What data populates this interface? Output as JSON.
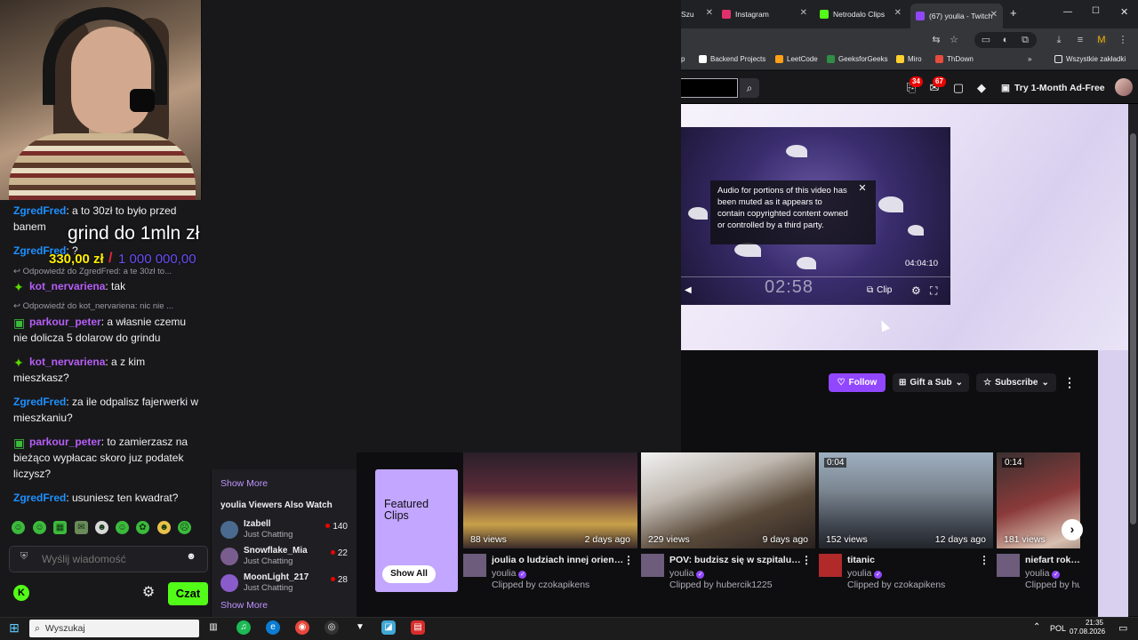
{
  "browser": {
    "tabs": [
      {
        "label": "Szu",
        "color": "#4285f4"
      },
      {
        "label": "Instagram",
        "color": "#e1306c"
      },
      {
        "label": "Netrodalo Clips",
        "color": "#53fc18"
      },
      {
        "label": "(67) youlia - Twitch",
        "color": "#9147ff"
      }
    ],
    "new_tab": "+",
    "bookmarks": [
      {
        "label": "Backend Projects",
        "color": "#ffffff"
      },
      {
        "label": "LeetCode",
        "color": "#ffa116"
      },
      {
        "label": "GeeksforGeeks",
        "color": "#2f8d46"
      },
      {
        "label": "Miro",
        "color": "#ffd02f"
      },
      {
        "label": "ThDown",
        "color": "#e74c3c"
      }
    ],
    "bookmarks_folder": "Wszystkie zakładki",
    "bookmark_partial": "p"
  },
  "twitch": {
    "search_placeholder": "",
    "notif_count_a": "34",
    "notif_count_b": "67",
    "ad_free_label": "Try 1-Month Ad-Free",
    "mute_notice": "Audio for portions of this video has been muted as it appears to contain copyrighted content owned or controlled by a third party.",
    "video_time": "04:04:10",
    "video_clock": "02:58",
    "clip_label": "Clip",
    "follow_label": "Follow",
    "gift_label": "Gift a Sub",
    "subscribe_label": "Subscribe"
  },
  "overlay": {
    "goal_text": "grind do 1mln zł",
    "current": "330,00 zł",
    "slash": "/",
    "target": "1 000 000,00"
  },
  "chat": {
    "messages": [
      {
        "type": "msg",
        "user": "ZgredFred",
        "user_color": "#1e90ff",
        "text": ": a to 30zł to było przed banem"
      },
      {
        "type": "msg",
        "user": "ZgredFred",
        "user_color": "#1e90ff",
        "text": ": ?"
      },
      {
        "type": "reply",
        "text": "Odpowiedź do ZgredFred: a te 30zł to..."
      },
      {
        "type": "msg",
        "user": "kot_nervariena",
        "user_color": "#b65ef5",
        "text": ": tak"
      },
      {
        "type": "reply",
        "text": "Odpowiedź do kot_nervariena: nic nie ..."
      },
      {
        "type": "msg",
        "user": "parkour_peter",
        "user_color": "#b65ef5",
        "text": ": a własnie czemu nie dolicza 5 dolarow do grindu"
      },
      {
        "type": "msg",
        "user": "kot_nervariena",
        "user_color": "#b65ef5",
        "text": ": a z kim mieszkasz?"
      },
      {
        "type": "msg",
        "user": "ZgredFred",
        "user_color": "#1e90ff",
        "text": ": za ile odpalisz fajerwerki w mieszkaniu?"
      },
      {
        "type": "msg",
        "user": "parkour_peter",
        "user_color": "#b65ef5",
        "text": ": to zamierzasz na bieżąco wypłacac skoro juz podatek liczysz?"
      },
      {
        "type": "msg",
        "user": "ZgredFred",
        "user_color": "#1e90ff",
        "text": ": usuniesz ten kwadrat?"
      }
    ],
    "input_placeholder": "Wyślij wiadomość",
    "send_label": "Czat",
    "kick_logo": "K"
  },
  "viewers": {
    "show_more_top": "Show More",
    "title": "youlia Viewers Also Watch",
    "items": [
      {
        "name": "Izabell",
        "game": "Just Chatting",
        "count": "140"
      },
      {
        "name": "Snowflake_Mia",
        "game": "Just Chatting",
        "count": "22"
      },
      {
        "name": "MoonLight_217",
        "game": "Just Chatting",
        "count": "28"
      }
    ],
    "show_more_bottom": "Show More"
  },
  "clips": {
    "featured_title": "Featured Clips",
    "show_all": "Show All",
    "items": [
      {
        "views": "88 views",
        "ago": "2 days ago",
        "duration": "",
        "title": "joulia o ludziach innej orientacji",
        "channel": "youlia",
        "by": "Clipped by czokapikens"
      },
      {
        "views": "229 views",
        "ago": "9 days ago",
        "duration": "",
        "title": "POV: budzisz się w szpitalu ps...",
        "channel": "youlia",
        "by": "Clipped by hubercik1225"
      },
      {
        "views": "152 views",
        "ago": "12 days ago",
        "duration": "0:04",
        "title": "titanic",
        "channel": "youlia",
        "by": "Clipped by czokapikens"
      },
      {
        "views": "181 views",
        "ago": "",
        "duration": "0:14",
        "title": "niefart roku a",
        "channel": "youlia",
        "by": "Clipped by hu"
      }
    ]
  },
  "taskbar": {
    "search_label": "Wyszukaj",
    "lang": "POL",
    "time": "21:35",
    "date": "07.08.2026"
  }
}
